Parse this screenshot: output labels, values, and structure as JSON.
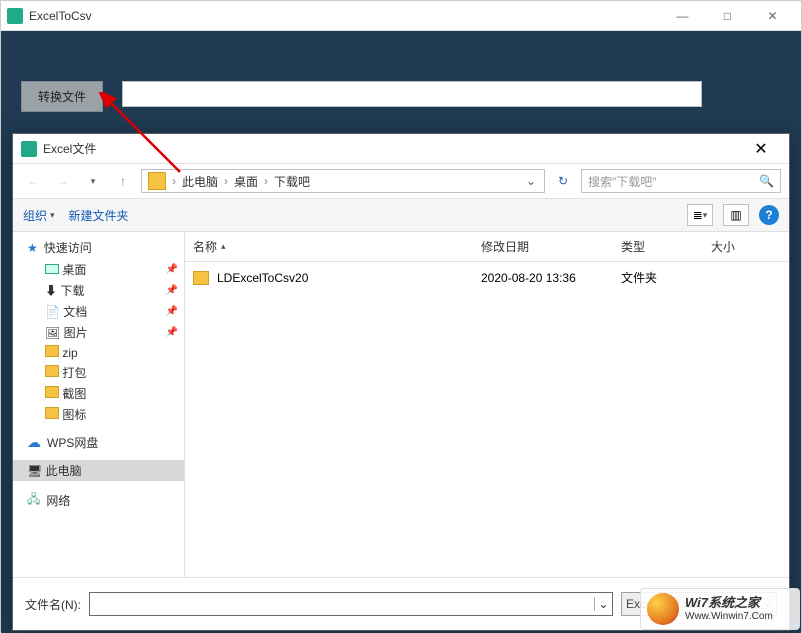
{
  "app": {
    "title": "ExcelToCsv",
    "convert_btn": "转换文件"
  },
  "dialog": {
    "title": "Excel文件",
    "breadcrumb": [
      "此电脑",
      "桌面",
      "下载吧"
    ],
    "search_placeholder": "搜索\"下载吧\"",
    "toolbar": {
      "organize": "组织",
      "new_folder": "新建文件夹"
    },
    "sidebar": {
      "quick_access": "快速访问",
      "items": [
        "桌面",
        "下载",
        "文档",
        "图片",
        "zip",
        "打包",
        "截图",
        "图标"
      ],
      "wps": "WPS网盘",
      "this_pc": "此电脑",
      "network": "网络"
    },
    "columns": {
      "name": "名称",
      "date": "修改日期",
      "type": "类型",
      "size": "大小"
    },
    "files": [
      {
        "name": "LDExcelToCsv20",
        "date": "2020-08-20 13:36",
        "type": "文件夹",
        "size": ""
      }
    ],
    "filename_label": "文件名(N):",
    "filter": "Excel All(*.xls, *.xlsx)"
  },
  "watermark": {
    "line1": "Wi7系统之家",
    "line2": "Www.Winwin7.Com"
  }
}
